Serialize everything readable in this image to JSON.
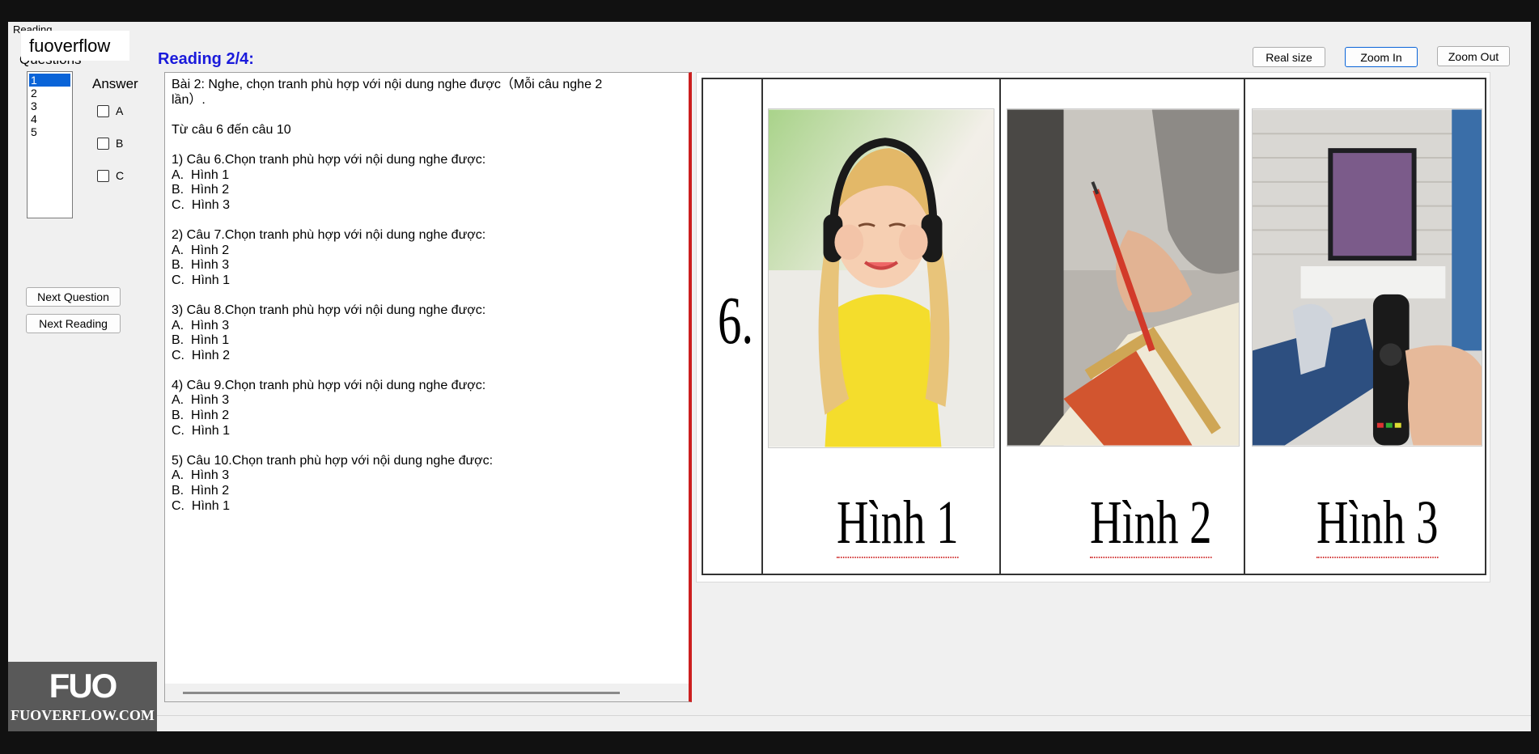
{
  "window": {
    "title": "Reading",
    "brand": "fuoverflow"
  },
  "sidebar": {
    "questions_label": "Questions",
    "questions": [
      "1",
      "2",
      "3",
      "4",
      "5"
    ],
    "selected_index": 0,
    "answer_label": "Answer",
    "options": [
      "A",
      "B",
      "C"
    ],
    "next_question_label": "Next Question",
    "next_reading_label": "Next Reading"
  },
  "header": {
    "reading_title": "Reading 2/4:"
  },
  "toolbar": {
    "real_size_label": "Real size",
    "zoom_in_label": "Zoom In",
    "zoom_out_label": "Zoom Out"
  },
  "reading_text": "Bài 2: Nghe, chọn tranh phù hợp với nội dung nghe được（Mỗi câu nghe 2\nlần）.\n\nTừ câu 6 đến câu 10\n\n1) Câu 6.Chọn tranh phù hợp với nội dung nghe được:\nA.  Hình 1\nB.  Hình 2\nC.  Hình 3\n\n2) Câu 7.Chọn tranh phù hợp với nội dung nghe được:\nA.  Hình 2\nB.  Hình 3\nC.  Hình 1\n\n3) Câu 8.Chọn tranh phù hợp với nội dung nghe được:\nA.  Hình 3\nB.  Hình 1\nC.  Hình 2\n\n4) Câu 9.Chọn tranh phù hợp với nội dung nghe được:\nA.  Hình 3\nB.  Hình 2\nC.  Hình 1\n\n5) Câu 10.Chọn tranh phù hợp với nội dung nghe được:\nA.  Hình 3\nB.  Hình 2\nC.  Hình 1",
  "figure": {
    "number": "6.",
    "labels": [
      "Hình 1",
      "Hình 2",
      "Hình 3"
    ],
    "pictures": [
      "girl-with-headphones",
      "hand-writing-with-pen",
      "hand-holding-tv-remote"
    ]
  },
  "watermark": {
    "logo": "FUO",
    "site": "FUOVERFLOW.COM"
  }
}
